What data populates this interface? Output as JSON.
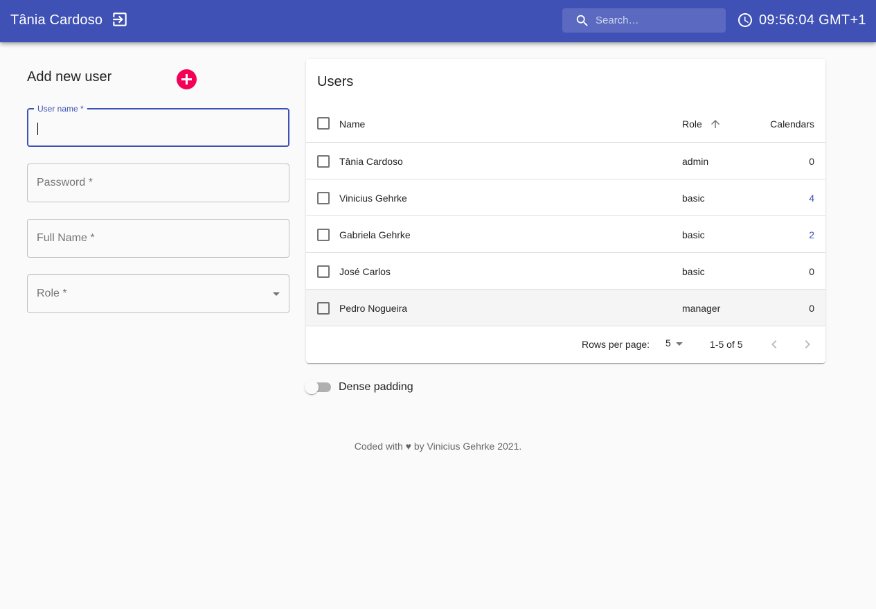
{
  "appbar": {
    "user_name": "Tânia Cardoso",
    "logout_icon": "logout-icon",
    "search_placeholder": "Search…",
    "search_value": "",
    "clock_icon": "clock-icon",
    "time": "09:56:04 GMT+1",
    "color": "#3f51b5"
  },
  "form": {
    "title": "Add new user",
    "add_icon": "add-circle-icon",
    "add_color": "#f50057",
    "fields": {
      "username": {
        "label": "User name *",
        "value": ""
      },
      "password": {
        "label": "Password *",
        "value": ""
      },
      "fullname": {
        "label": "Full Name *",
        "value": ""
      },
      "role": {
        "label": "Role *",
        "value": ""
      }
    }
  },
  "table": {
    "title": "Users",
    "columns": {
      "name": "Name",
      "role": "Role",
      "calendars": "Calendars"
    },
    "sort": {
      "column": "role",
      "direction": "asc"
    },
    "rows": [
      {
        "name": "Tânia Cardoso",
        "role": "admin",
        "calendars": "0"
      },
      {
        "name": "Vinicius Gehrke",
        "role": "basic",
        "calendars": "4"
      },
      {
        "name": "Gabriela Gehrke",
        "role": "basic",
        "calendars": "2"
      },
      {
        "name": "José Carlos",
        "role": "basic",
        "calendars": "0"
      },
      {
        "name": "Pedro Nogueira",
        "role": "manager",
        "calendars": "0"
      }
    ],
    "pagination": {
      "rows_per_page_label": "Rows per page:",
      "rows_per_page": "5",
      "range": "1-5 of 5"
    }
  },
  "dense": {
    "label": "Dense padding",
    "checked": false
  },
  "footer": {
    "text": "Coded with ♥ by Vinicius Gehrke 2021."
  }
}
